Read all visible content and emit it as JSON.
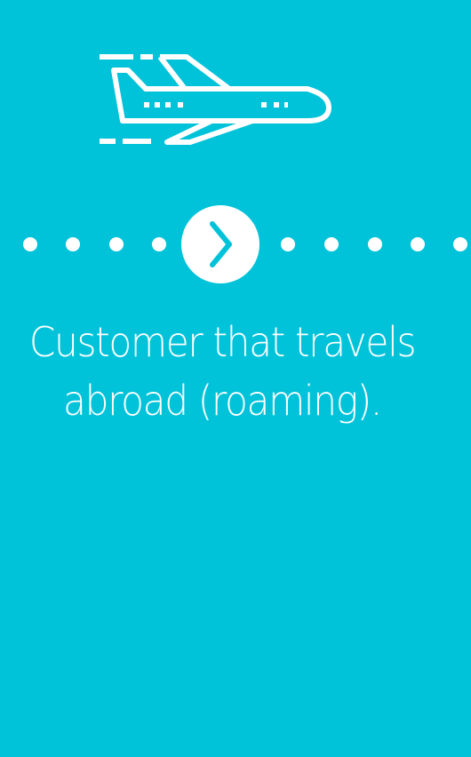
{
  "theme": {
    "background": "#00c3da",
    "foreground": "#ffffff"
  },
  "icons": {
    "hero": "airplane-icon",
    "next": "chevron-right-icon"
  },
  "pagination": {
    "dots_before": 4,
    "dots_after": 5
  },
  "caption": {
    "line1": "Customer that travels",
    "line2": "abroad (roaming)."
  }
}
